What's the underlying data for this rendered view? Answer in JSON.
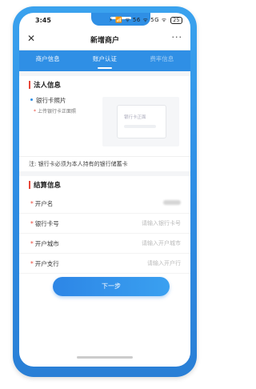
{
  "status_bar": {
    "time": "3:45",
    "icons": "⚡ 📶 ᯤ 56 ᯤ 5G ᯤ",
    "battery": "25"
  },
  "nav": {
    "close_icon": "close-icon",
    "title": "新增商户",
    "more_icon": "more-icon",
    "more_glyph": "···"
  },
  "tabs": [
    {
      "label": "商户信息",
      "state": "normal"
    },
    {
      "label": "账户认证",
      "state": "active"
    },
    {
      "label": "费率信息",
      "state": "disabled"
    }
  ],
  "legal_section": {
    "title": "法人信息",
    "upload_label": "银行卡照片",
    "upload_hint": "上传银行卡正面照",
    "card_placeholder_text": "银行卡正面",
    "note": "注: 银行卡必须为本人持有的银行储蓄卡"
  },
  "settlement_section": {
    "title": "结算信息",
    "fields": [
      {
        "label": "开户名",
        "value": "",
        "placeholder": ""
      },
      {
        "label": "银行卡号",
        "value": "",
        "placeholder": "请输入银行卡号"
      },
      {
        "label": "开户城市",
        "value": "",
        "placeholder": "请输入开户城市"
      },
      {
        "label": "开户支行",
        "value": "",
        "placeholder": "请输入开户行"
      }
    ]
  },
  "next_button": "下一步",
  "colors": {
    "brand_blue": "#2f8fe5",
    "accent_red": "#e8483b"
  }
}
